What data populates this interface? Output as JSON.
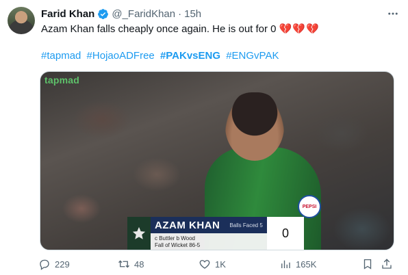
{
  "author": {
    "display_name": "Farid Khan",
    "handle": "@_FaridKhan",
    "time": "15h"
  },
  "tweet": {
    "text": "Azam Khan falls cheaply once again. He is out for 0",
    "emoji": "💔💔💔",
    "hashtags": [
      {
        "tag": "#tapmad",
        "bold": false
      },
      {
        "tag": "#HojaoADFree",
        "bold": false
      },
      {
        "tag": "#PAKvsENG",
        "bold": true
      },
      {
        "tag": "#ENGvPAK",
        "bold": false
      }
    ]
  },
  "media": {
    "watermark": "tapmad",
    "sponsor": "PEPSI",
    "scorecard": {
      "player": "AZAM KHAN",
      "balls_faced": "Balls Faced 5",
      "score": "0",
      "dismissal": "c Buttler b Wood",
      "fall_of_wicket": "Fall of Wicket 86-5"
    }
  },
  "actions": {
    "replies": "229",
    "reposts": "48",
    "likes": "1K",
    "views": "165K"
  },
  "colors": {
    "link": "#1d9bf0",
    "muted": "#536471",
    "verified": "#1d9bf0",
    "broken_heart": "#e0245e"
  }
}
